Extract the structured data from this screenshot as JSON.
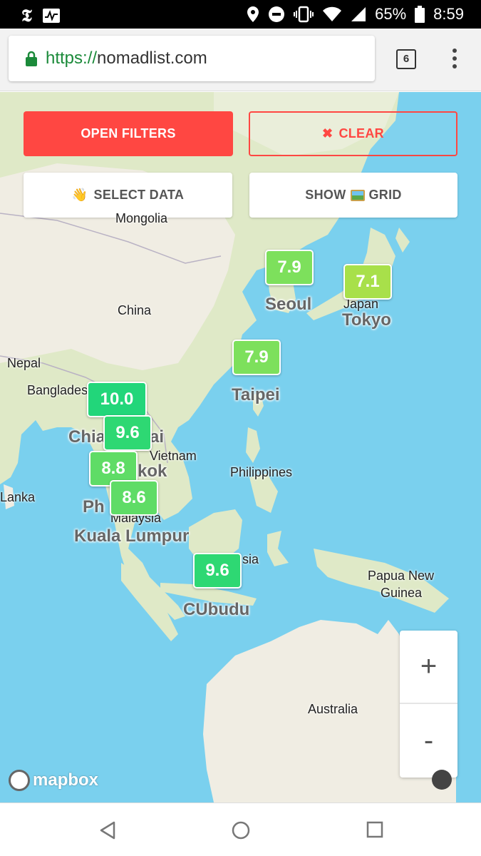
{
  "status_bar": {
    "battery_percent": "65%",
    "time": "8:59"
  },
  "browser": {
    "url_scheme": "https://",
    "url_host": "nomadlist.com",
    "tab_count": "6"
  },
  "buttons": {
    "open_filters": "OPEN FILTERS",
    "clear": "CLEAR",
    "select_data": "SELECT DATA",
    "show_grid_prefix": "SHOW",
    "show_grid_suffix": "GRID"
  },
  "map_labels": {
    "mongolia": "Mongolia",
    "china": "China",
    "nepal": "Nepal",
    "bangladesh": "Bangladesh",
    "vietnam": "Vietnam",
    "philippines": "Philippines",
    "lanka": "Lanka",
    "malaysia": "Malaysia",
    "indonesia": "sia",
    "papua": "Papua New",
    "guinea": "Guinea",
    "australia": "Australia",
    "japan": "Japan"
  },
  "cities": {
    "seoul": "Seoul",
    "tokyo": "Tokyo",
    "taipei": "Taipei",
    "chiang_mai_a": "Chia",
    "chiang_mai_b": "ai",
    "bangkok": "kok",
    "phuket": "Ph",
    "kuala_lumpur": "Kuala Lumpur",
    "ubud": "CUbudu"
  },
  "scores": {
    "seoul": "7.9",
    "tokyo": "7.1",
    "taipei": "7.9",
    "chiang_mai": "10.0",
    "bangkok": "9.6",
    "phuket": "8.8",
    "kuala_lumpur": "8.6",
    "ubud": "9.6"
  },
  "zoom": {
    "in": "+",
    "out": "-"
  },
  "attribution": "mapbox",
  "colors": {
    "water": "#7ad0ee",
    "land": "#f0ede3",
    "land_green": "#dfe9c7",
    "accent_red": "#ff4742",
    "marker_top": "#22d67a",
    "marker_high": "#4fde6e",
    "marker_mid": "#7de05c",
    "marker_low": "#a8e04a"
  }
}
